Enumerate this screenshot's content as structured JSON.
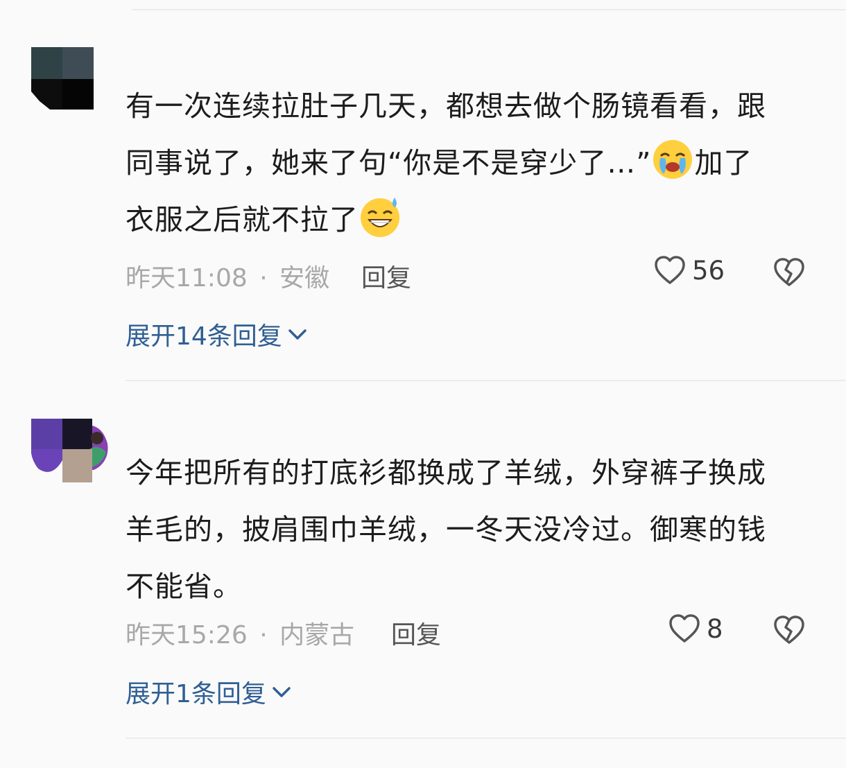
{
  "comments": [
    {
      "text_lines": [
        "有一次连续拉肚子几天，都想去做个肠镜看看，跟",
        "同事说了，她来了句“你是不是穿少了…”",
        "加了",
        "衣服之后就不拉了"
      ],
      "time": "昨天11:08",
      "sep": "·",
      "region": "安徽",
      "reply_label": "回复",
      "likes": "56",
      "expand_label": "展开14条回复"
    },
    {
      "text_lines": [
        "今年把所有的打底衫都换成了羊绒，外穿裤子换成",
        "羊毛的，披肩围巾羊绒，一冬天没冷过。御寒的钱",
        "不能省。"
      ],
      "time": "昨天15:26",
      "sep": "·",
      "region": "内蒙古",
      "reply_label": "回复",
      "likes": "8",
      "expand_label": "展开1条回复"
    }
  ],
  "icons": {
    "like": "heart-outline-icon",
    "dislike": "broken-heart-icon",
    "expand": "chevron-down-icon",
    "emoji_1": "crying-face-emoji",
    "emoji_2": "grinning-sweat-emoji"
  },
  "colors": {
    "link": "#2f5f93",
    "meta": "#a8a8a8",
    "text": "#1c1c1c"
  }
}
